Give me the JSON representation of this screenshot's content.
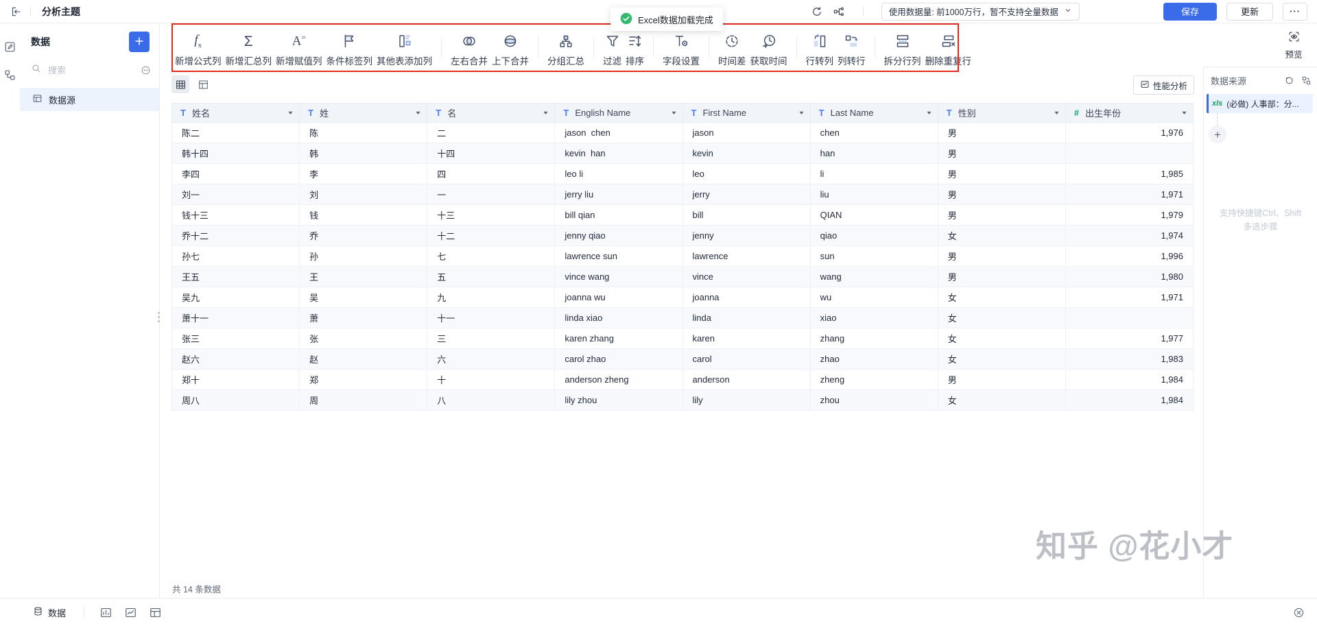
{
  "topbar": {
    "title": "分析主题",
    "data_volume_label": "使用数据量: 前1000万行，暂不支持全量数据",
    "save_label": "保存",
    "update_label": "更新"
  },
  "toast": {
    "text": "Excel数据加载完成"
  },
  "toolbar": {
    "groups": [
      {
        "items": [
          {
            "name": "add-formula-column",
            "icon": "formula-icon",
            "label": "新增公式列"
          },
          {
            "name": "add-summary-column",
            "icon": "sum-icon",
            "label": "新增汇总列"
          },
          {
            "name": "add-assign-column",
            "icon": "assign-icon",
            "label": "新增赋值列"
          },
          {
            "name": "condition-tag-column",
            "icon": "flag-icon",
            "label": "条件标签列"
          },
          {
            "name": "add-column-from-other-table",
            "icon": "add-column-icon",
            "label": "其他表添加列"
          }
        ]
      },
      {
        "items": [
          {
            "name": "join-left-right",
            "icon": "join-lr-icon",
            "label": "左右合并"
          },
          {
            "name": "join-up-down",
            "icon": "join-ud-icon",
            "label": "上下合并"
          }
        ]
      },
      {
        "items": [
          {
            "name": "group-summary",
            "icon": "group-summary-icon",
            "label": "分组汇总"
          }
        ]
      },
      {
        "items": [
          {
            "name": "filter",
            "icon": "filter-icon",
            "label": "过滤"
          },
          {
            "name": "sort",
            "icon": "sort-icon",
            "label": "排序"
          }
        ]
      },
      {
        "items": [
          {
            "name": "field-settings",
            "icon": "field-settings-icon",
            "label": "字段设置"
          }
        ]
      },
      {
        "items": [
          {
            "name": "time-diff",
            "icon": "time-diff-icon",
            "label": "时间差"
          },
          {
            "name": "get-time",
            "icon": "get-time-icon",
            "label": "获取时间"
          }
        ]
      },
      {
        "items": [
          {
            "name": "row-to-column",
            "icon": "row-to-col-icon",
            "label": "行转列"
          },
          {
            "name": "column-to-row",
            "icon": "col-to-row-icon",
            "label": "列转行"
          }
        ]
      },
      {
        "items": [
          {
            "name": "split-row-column",
            "icon": "split-icon",
            "label": "拆分行列"
          },
          {
            "name": "remove-duplicate-rows",
            "icon": "dedup-icon",
            "label": "删除重复行"
          }
        ]
      }
    ]
  },
  "sidebar": {
    "title": "数据",
    "search_placeholder": "搜索",
    "items": [
      {
        "label": "数据源"
      }
    ]
  },
  "preview_label": "预览",
  "table": {
    "performance_label": "性能分析",
    "columns": [
      {
        "label": "姓名",
        "type": "text"
      },
      {
        "label": "姓",
        "type": "text"
      },
      {
        "label": "名",
        "type": "text"
      },
      {
        "label": "English Name",
        "type": "text"
      },
      {
        "label": "First Name",
        "type": "text"
      },
      {
        "label": "Last Name",
        "type": "text"
      },
      {
        "label": "性别",
        "type": "text"
      },
      {
        "label": "出生年份",
        "type": "number"
      }
    ],
    "rows": [
      [
        "陈二",
        "陈",
        "二",
        "jason  chen",
        "jason",
        "chen",
        "男",
        "1,976"
      ],
      [
        "韩十四",
        "韩",
        "十四",
        "kevin  han",
        "kevin",
        "han",
        "男",
        ""
      ],
      [
        "李四",
        "李",
        "四",
        "leo li",
        "leo",
        "li",
        "男",
        "1,985"
      ],
      [
        "刘一",
        "刘",
        "一",
        "jerry liu",
        "jerry",
        "liu",
        "男",
        "1,971"
      ],
      [
        "钱十三",
        "钱",
        "十三",
        "bill qian",
        "bill",
        "QIAN",
        "男",
        "1,979"
      ],
      [
        "乔十二",
        "乔",
        "十二",
        "jenny qiao",
        "jenny",
        "qiao",
        "女",
        "1,974"
      ],
      [
        "孙七",
        "孙",
        "七",
        "lawrence sun",
        "lawrence",
        "sun",
        "男",
        "1,996"
      ],
      [
        "王五",
        "王",
        "五",
        "vince wang",
        "vince",
        "wang",
        "男",
        "1,980"
      ],
      [
        "吴九",
        "吴",
        "九",
        "joanna wu",
        "joanna",
        "wu",
        "女",
        "1,971"
      ],
      [
        "萧十一",
        "萧",
        "十一",
        "linda xiao",
        "linda",
        "xiao",
        "女",
        ""
      ],
      [
        "张三",
        "张",
        "三",
        "karen zhang",
        "karen",
        "zhang",
        "女",
        "1,977"
      ],
      [
        "赵六",
        "赵",
        "六",
        "carol zhao",
        "carol",
        "zhao",
        "女",
        "1,983"
      ],
      [
        "郑十",
        "郑",
        "十",
        "anderson zheng",
        "anderson",
        "zheng",
        "男",
        "1,984"
      ],
      [
        "周八",
        "周",
        "八",
        "lily zhou",
        "lily",
        "zhou",
        "女",
        "1,984"
      ]
    ],
    "row_count_text": "共 14 条数据"
  },
  "right_panel": {
    "title": "数据来源",
    "source_badge": "xls",
    "source_label": "(必做) 人事部：分...",
    "hint_line1": "支持快捷键Ctrl、Shift",
    "hint_line2": "多选步骤"
  },
  "bottom_bar": {
    "tab_label": "数据"
  },
  "watermark": "知乎 @花小才",
  "colors": {
    "accent_blue": "#3A6BE8",
    "annotation_red": "#E02A20",
    "toast_green": "#33B96E",
    "text_field_blue": "#4D7BE8",
    "number_field_green": "#15A880"
  }
}
